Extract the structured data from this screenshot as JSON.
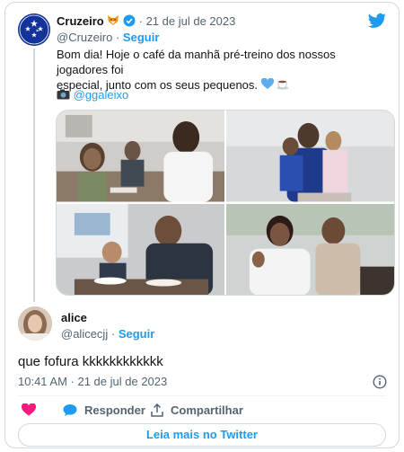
{
  "tweet": {
    "author_name": "Cruzeiro",
    "date": "21 de jul de 2023",
    "handle": "@Cruzeiro",
    "follow_label": "Seguir",
    "text_line1": "Bom dia! Hoje o café da manhã pré-treino dos nossos jogadores foi",
    "text_line2": "especial, junto com os seus pequenos.",
    "photo_credit": "@ggaleixo",
    "separator": "·"
  },
  "reply": {
    "author_name": "alice",
    "handle": "@alicecjj",
    "follow_label": "Seguir",
    "separator": "·",
    "text": "que fofura kkkkkkkkkkkk",
    "timestamp": "10:41 AM · 21 de jul de 2023"
  },
  "actions": {
    "reply_label": "Responder",
    "share_label": "Compartilhar",
    "read_more_label": "Leia mais no Twitter"
  },
  "icons": {
    "bird": "twitter-bird-icon",
    "verified": "verified-badge-icon",
    "emoji_fox": "fox-emoji-icon",
    "emoji_heart": "blue-heart-emoji-icon",
    "emoji_coffee": "coffee-emoji-icon",
    "camera": "camera-emoji-icon",
    "like": "heart-icon",
    "reply": "speech-bubble-icon",
    "share": "share-icon",
    "info": "info-icon"
  },
  "colors": {
    "accent": "#1d9bf0",
    "like_red": "#f91880",
    "brand_blue": "#13339a",
    "text_primary": "#0f1419",
    "text_secondary": "#536471",
    "border": "#cfd9de"
  }
}
